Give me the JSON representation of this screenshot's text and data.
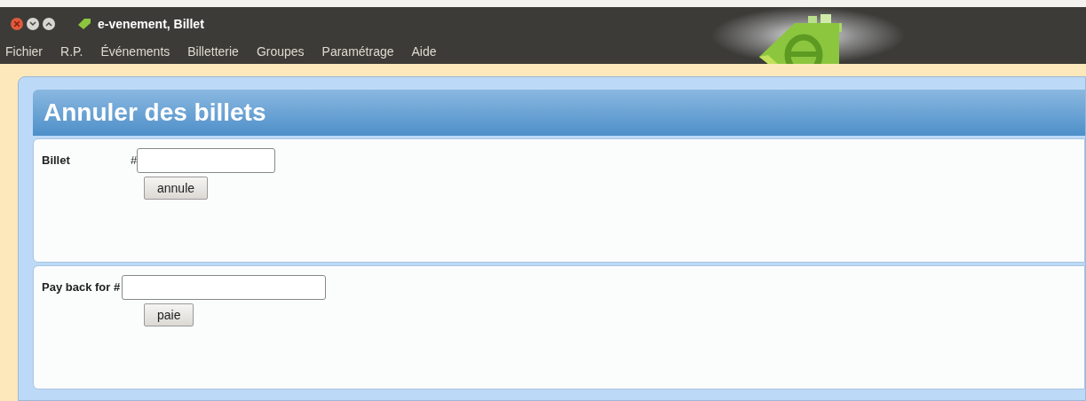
{
  "window": {
    "title": "e-venement, Billet"
  },
  "menu": [
    "Fichier",
    "R.P.",
    "Événements",
    "Billetterie",
    "Groupes",
    "Paramétrage",
    "Aide"
  ],
  "page": {
    "title": "Annuler des billets"
  },
  "sections": [
    {
      "label": "Billet",
      "hash": "#",
      "button": "annule",
      "kind": "short"
    },
    {
      "label": "Pay back for #",
      "button": "paie",
      "kind": "long"
    }
  ]
}
